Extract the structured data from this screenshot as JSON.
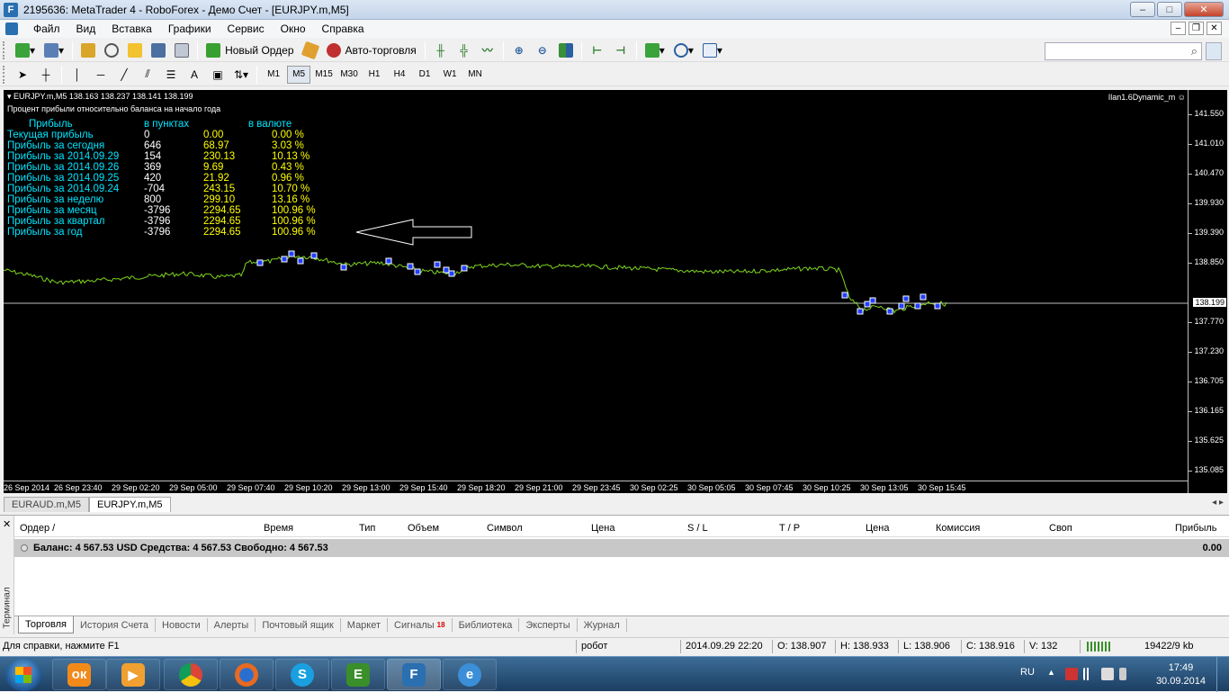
{
  "window": {
    "title": "2195636: MetaTrader 4 - RoboForex - Демо Счет - [EURJPY.m,M5]",
    "app_icon": "metatrader-icon",
    "controls": [
      "–",
      "□",
      "✕"
    ]
  },
  "menu": {
    "items": [
      "Файл",
      "Вид",
      "Вставка",
      "Графики",
      "Сервис",
      "Окно",
      "Справка"
    ],
    "mdi_controls": [
      "–",
      "❐",
      "✕"
    ]
  },
  "toolbar": {
    "new_order_label": "Новый Ордер",
    "autotrade_label": "Авто-торговля",
    "search_placeholder": "",
    "timeframes": [
      "M1",
      "M5",
      "M15",
      "M30",
      "H1",
      "H4",
      "D1",
      "W1",
      "MN"
    ],
    "active_timeframe": "M5"
  },
  "chart": {
    "header": "EURJPY.m,M5  138.163 138.237 138.141 138.199",
    "subtitle": "Процент прибыли относительно баланса на начало года",
    "ea_name": "Ilan1.6Dynamic_m",
    "stats_header": [
      "Прибыль",
      "в пунктах",
      "в валюте"
    ],
    "stats": [
      {
        "label": "Текущая прибыль",
        "points": "0",
        "money": "0.00",
        "pct": "0.00 %"
      },
      {
        "label": "Прибыль за сегодня",
        "points": "646",
        "money": "68.97",
        "pct": "3.03 %"
      },
      {
        "label": "Прибыль за 2014.09.29",
        "points": "154",
        "money": "230.13",
        "pct": "10.13 %"
      },
      {
        "label": "Прибыль за 2014.09.26",
        "points": "369",
        "money": "9.69",
        "pct": "0.43 %"
      },
      {
        "label": "Прибыль за 2014.09.25",
        "points": "420",
        "money": "21.92",
        "pct": "0.96 %"
      },
      {
        "label": "Прибыль за 2014.09.24",
        "points": "-704",
        "money": "243.15",
        "pct": "10.70 %"
      },
      {
        "label": "Прибыль за неделю",
        "points": "800",
        "money": "299.10",
        "pct": "13.16 %"
      },
      {
        "label": "Прибыль за месяц",
        "points": "-3796",
        "money": "2294.65",
        "pct": "100.96 %"
      },
      {
        "label": "Прибыль за квартал",
        "points": "-3796",
        "money": "2294.65",
        "pct": "100.96 %"
      },
      {
        "label": "Прибыль за год",
        "points": "-3796",
        "money": "2294.65",
        "pct": "100.96 %"
      }
    ],
    "price_ticks": [
      "141.550",
      "141.010",
      "140.470",
      "139.930",
      "139.390",
      "138.850",
      "137.770",
      "137.230",
      "136.705",
      "136.165",
      "135.625",
      "135.085"
    ],
    "current_price": "138.199",
    "time_ticks": [
      "26 Sep 2014",
      "26 Sep 23:40",
      "29 Sep 02:20",
      "29 Sep 05:00",
      "29 Sep 07:40",
      "29 Sep 10:20",
      "29 Sep 13:00",
      "29 Sep 15:40",
      "29 Sep 18:20",
      "29 Sep 21:00",
      "29 Sep 23:45",
      "30 Sep 02:25",
      "30 Sep 05:05",
      "30 Sep 07:45",
      "30 Sep 10:25",
      "30 Sep 13:05",
      "30 Sep 15:45"
    ],
    "colors": {
      "background": "#000000",
      "line": "#7fd61e",
      "text": "#ffffff",
      "label": "#00e5ff",
      "value": "#ffff00",
      "marker": "#2040ff"
    }
  },
  "chart_tabs": [
    "EURAUD.m,M5",
    "EURJPY.m,M5"
  ],
  "active_chart_tab": "EURJPY.m,M5",
  "terminal": {
    "side_label": "Терминал",
    "columns": [
      "Ордер  /",
      "Время",
      "Тип",
      "Объем",
      "Символ",
      "Цена",
      "S / L",
      "T / P",
      "Цена",
      "Комиссия",
      "Своп",
      "Прибыль"
    ],
    "balance_text": "Баланс: 4 567.53 USD  Средства: 4 567.53  Свободно: 4 567.53",
    "balance_profit": "0.00",
    "tabs": [
      "Торговля",
      "История Счета",
      "Новости",
      "Алерты",
      "Почтовый ящик",
      "Маркет",
      "Сигналы",
      "Библиотека",
      "Эксперты",
      "Журнал"
    ],
    "signals_badge": "18"
  },
  "status": {
    "help": "Для справки, нажмите F1",
    "profile": "робот",
    "datetime": "2014.09.29 22:20",
    "open": "O: 138.907",
    "high": "H: 138.933",
    "low": "L: 138.906",
    "close": "C: 138.916",
    "volume": "V: 132",
    "traffic": "19422/9 kb"
  },
  "taskbar": {
    "apps": [
      "odnoklassniki-icon",
      "media-player-icon",
      "chrome-icon",
      "firefox-icon",
      "skype-icon",
      "evernote-icon",
      "metatrader-icon",
      "internet-explorer-icon"
    ],
    "lang": "RU",
    "time": "17:49",
    "date": "30.09.2014"
  }
}
